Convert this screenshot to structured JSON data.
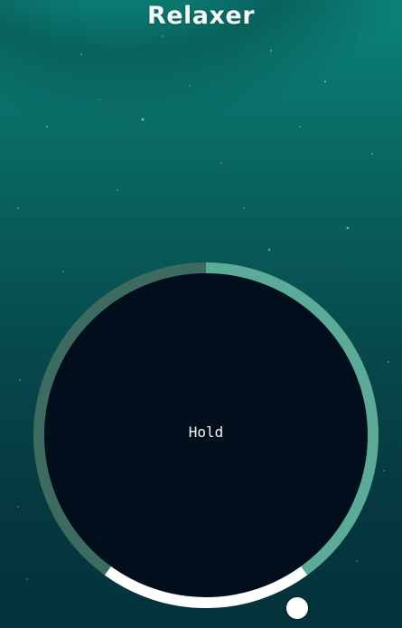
{
  "app": {
    "title": "Relaxer"
  },
  "breathing": {
    "instruction": "Hold",
    "phases": [
      {
        "name": "breathe-in",
        "color": "#5bab98",
        "fraction": 0.4
      },
      {
        "name": "hold",
        "color": "#ffffff",
        "fraction": 0.2
      },
      {
        "name": "breathe-out",
        "color": "#3e6b5f",
        "fraction": 0.4
      }
    ],
    "progress": 0.36
  },
  "colors": {
    "circle_fill": "#010f1c",
    "text": "#f2f5f4",
    "pointer": "#ffffff"
  }
}
